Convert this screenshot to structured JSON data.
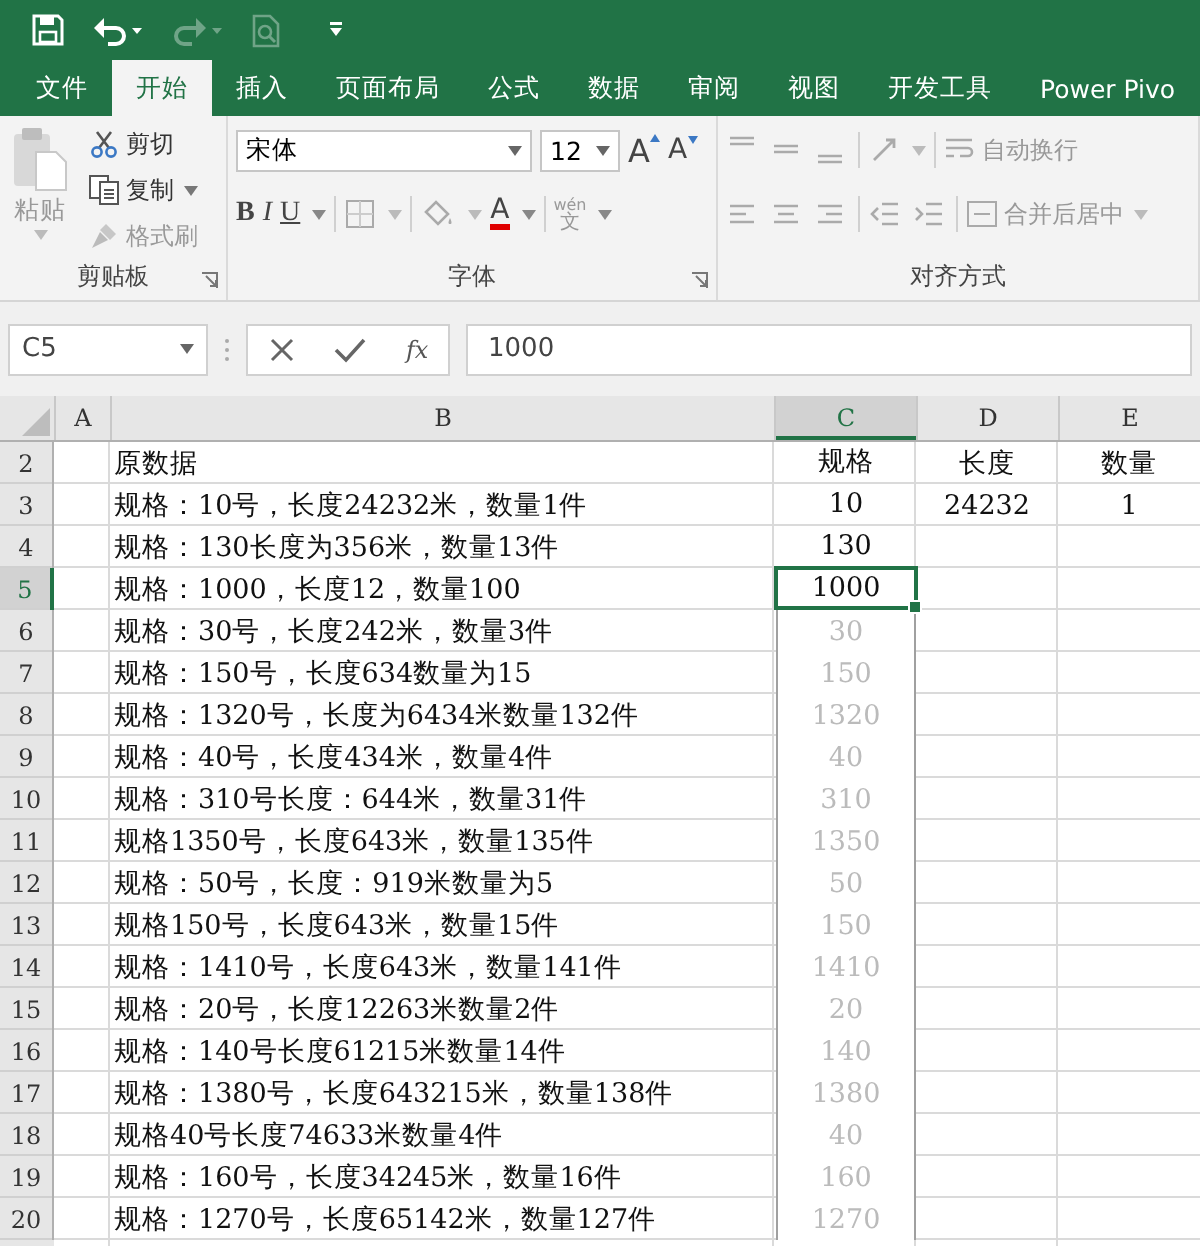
{
  "quick_access": [
    {
      "kind": "save",
      "disabled": false
    },
    {
      "kind": "undo",
      "disabled": false
    },
    {
      "kind": "redo",
      "disabled": true
    },
    {
      "kind": "preview",
      "disabled": true
    },
    {
      "kind": "customize",
      "disabled": false
    }
  ],
  "tabs": [
    {
      "label": "文件",
      "selected": false
    },
    {
      "label": "开始",
      "selected": true
    },
    {
      "label": "插入",
      "selected": false
    },
    {
      "label": "页面布局",
      "selected": false
    },
    {
      "label": "公式",
      "selected": false
    },
    {
      "label": "数据",
      "selected": false
    },
    {
      "label": "审阅",
      "selected": false
    },
    {
      "label": "视图",
      "selected": false
    },
    {
      "label": "开发工具",
      "selected": false
    },
    {
      "label": "Power Pivo",
      "selected": false
    }
  ],
  "clipboard": {
    "paste": "粘贴",
    "cut": "剪切",
    "copy": "复制",
    "format_painter": "格式刷",
    "label": "剪贴板"
  },
  "font": {
    "name": "宋体",
    "size": "12",
    "grow": "A",
    "shrink": "A",
    "bold": "B",
    "italic": "I",
    "underline": "U",
    "color_letter": "A",
    "phonetic_top": "wén",
    "phonetic_bottom": "文",
    "label": "字体"
  },
  "alignment": {
    "wrap": "自动换行",
    "merge": "合并后居中",
    "label": "对齐方式"
  },
  "formula_bar": {
    "name_box": "C5",
    "function_symbol": "fx",
    "value": "1000"
  },
  "columns": [
    {
      "label": "A",
      "selected": false
    },
    {
      "label": "B",
      "selected": false
    },
    {
      "label": "C",
      "selected": true
    },
    {
      "label": "D",
      "selected": false
    },
    {
      "label": "E",
      "selected": false
    }
  ],
  "rows": [
    {
      "number": "2",
      "selected": false,
      "b": "原数据",
      "c": {
        "text": "规格",
        "preview": false,
        "selected": false
      },
      "d": "长度",
      "e": "数量"
    },
    {
      "number": "3",
      "selected": false,
      "b": "规格：10号，长度24232米，数量1件",
      "c": {
        "text": "10",
        "preview": false,
        "selected": false
      },
      "d": "24232",
      "e": "1"
    },
    {
      "number": "4",
      "selected": false,
      "b": "规格：130长度为356米，数量13件",
      "c": {
        "text": "130",
        "preview": false,
        "selected": false
      }
    },
    {
      "number": "5",
      "selected": true,
      "b": "规格：1000，长度12，数量100",
      "c": {
        "text": "1000",
        "preview": false,
        "selected": true
      }
    },
    {
      "number": "6",
      "selected": false,
      "b": "规格：30号，长度242米，数量3件",
      "c": {
        "text": "30",
        "preview": true,
        "selected": false
      }
    },
    {
      "number": "7",
      "selected": false,
      "b": "规格：150号，长度634数量为15",
      "c": {
        "text": "150",
        "preview": true,
        "selected": false
      }
    },
    {
      "number": "8",
      "selected": false,
      "b": "规格：1320号，长度为6434米数量132件",
      "c": {
        "text": "1320",
        "preview": true,
        "selected": false
      }
    },
    {
      "number": "9",
      "selected": false,
      "b": "规格：40号，长度434米，数量4件",
      "c": {
        "text": "40",
        "preview": true,
        "selected": false
      }
    },
    {
      "number": "10",
      "selected": false,
      "b": "规格：310号长度：644米，数量31件",
      "c": {
        "text": "310",
        "preview": true,
        "selected": false
      }
    },
    {
      "number": "11",
      "selected": false,
      "b": "规格1350号，长度643米，数量135件",
      "c": {
        "text": "1350",
        "preview": true,
        "selected": false
      }
    },
    {
      "number": "12",
      "selected": false,
      "b": "规格：50号，长度：919米数量为5",
      "c": {
        "text": "50",
        "preview": true,
        "selected": false
      }
    },
    {
      "number": "13",
      "selected": false,
      "b": "规格150号，长度643米，数量15件",
      "c": {
        "text": "150",
        "preview": true,
        "selected": false
      }
    },
    {
      "number": "14",
      "selected": false,
      "b": "规格：1410号，长度643米，数量141件",
      "c": {
        "text": "1410",
        "preview": true,
        "selected": false
      }
    },
    {
      "number": "15",
      "selected": false,
      "b": "规格：20号，长度12263米数量2件",
      "c": {
        "text": "20",
        "preview": true,
        "selected": false
      }
    },
    {
      "number": "16",
      "selected": false,
      "b": "规格：140号长度61215米数量14件",
      "c": {
        "text": "140",
        "preview": true,
        "selected": false
      }
    },
    {
      "number": "17",
      "selected": false,
      "b": "规格：1380号，长度643215米，数量138件",
      "c": {
        "text": "1380",
        "preview": true,
        "selected": false
      }
    },
    {
      "number": "18",
      "selected": false,
      "b": "规格40号长度74633米数量4件",
      "c": {
        "text": "40",
        "preview": true,
        "selected": false
      }
    },
    {
      "number": "19",
      "selected": false,
      "b": "规格：160号，长度34245米，数量16件",
      "c": {
        "text": "160",
        "preview": true,
        "selected": false
      }
    },
    {
      "number": "20",
      "selected": false,
      "b": "规格：1270号，长度65142米，数量127件",
      "c": {
        "text": "1270",
        "preview": true,
        "selected": false
      }
    }
  ]
}
